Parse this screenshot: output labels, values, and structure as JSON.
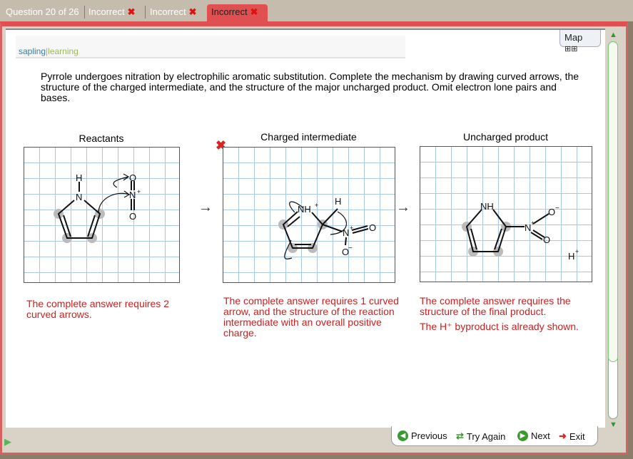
{
  "tabs": {
    "question": "Question 20 of 26",
    "items": [
      "Incorrect",
      "Incorrect",
      "Incorrect"
    ],
    "x": "✖"
  },
  "logo": {
    "a": "sapling",
    "b": "learning"
  },
  "map": {
    "label": "Map"
  },
  "question": "Pyrrole undergoes nitration by electrophilic aromatic substitution. Complete the mechanism by drawing curved arrows, the structure of the charged intermediate, and the structure of the major uncharged product. Omit electron lone pairs and bases.",
  "panels": [
    {
      "title": "Reactants",
      "feedback": "The complete answer requires 2 curved arrows."
    },
    {
      "title": "Charged intermediate",
      "feedback": "The complete answer requires 1 curved arrow, and the structure of the reaction intermediate with an overall positive charge."
    },
    {
      "title": "Uncharged product",
      "feedback": "The complete answer requires the structure of the final product.",
      "feedback2": "The H⁺ byproduct is already shown."
    }
  ],
  "atoms": {
    "H": "H",
    "N": "N",
    "O": "O",
    "NH": "NH",
    "NHplus": "NH",
    "plus": "+",
    "minus": "−",
    "Hplus": "H"
  },
  "nav": {
    "previous": "Previous",
    "try_again": "Try Again",
    "next": "Next",
    "exit": "Exit"
  },
  "colors": {
    "error": "#cc2020",
    "accent": "#e05050"
  }
}
